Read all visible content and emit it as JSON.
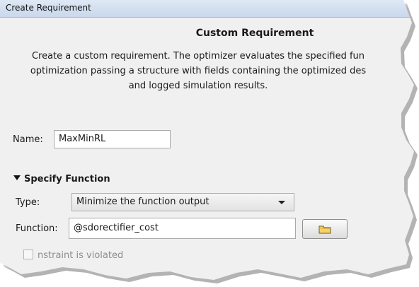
{
  "window": {
    "title": "Create Requirement"
  },
  "dialog": {
    "heading": "Custom Requirement",
    "description_lines": [
      "Create a custom requirement. The optimizer evaluates the specified fun",
      "optimization passing a structure with fields containing the optimized des",
      "and logged simulation results."
    ]
  },
  "form": {
    "name_label": "Name:",
    "name_value": "MaxMinRL",
    "section_title": "Specify Function",
    "type_label": "Type:",
    "type_value": "Minimize the function output",
    "function_label": "Function:",
    "function_value": "@sdorectifier_cost",
    "checkbox_label": "nstraint is violated"
  },
  "icons": {
    "expand": "triangle-down-icon",
    "browse": "folder-icon",
    "dropdown": "chevron-down-icon"
  },
  "colors": {
    "panel_bg": "#f0f0f0",
    "titlebar_top": "#dfe8f5",
    "titlebar_bottom": "#c9d8ec",
    "folder_fill": "#f4d36c"
  }
}
